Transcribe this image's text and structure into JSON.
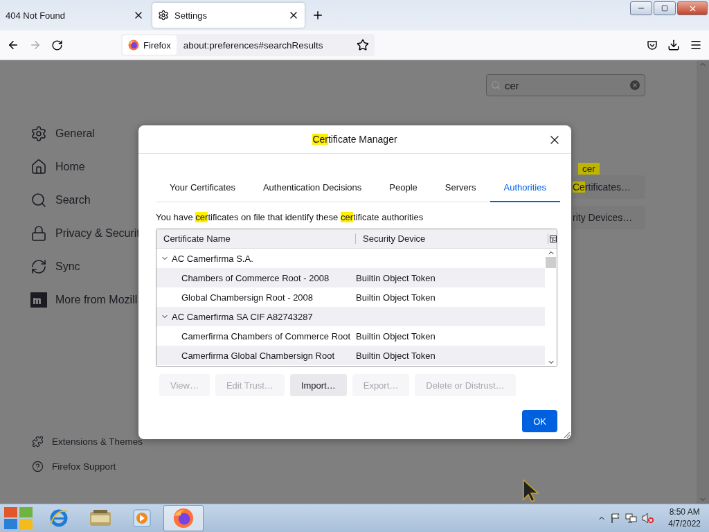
{
  "browser": {
    "tabs": [
      {
        "title": "404 Not Found",
        "selected": false
      },
      {
        "title": "Settings",
        "selected": true
      }
    ],
    "identity": "Firefox",
    "url": "about:preferences#searchResults"
  },
  "search": {
    "value": "cer"
  },
  "sidebar": {
    "items": [
      {
        "label": "General"
      },
      {
        "label": "Home"
      },
      {
        "label": "Search"
      },
      {
        "label": "Privacy & Securit"
      },
      {
        "label": "Sync"
      },
      {
        "label": "More from Mozill"
      }
    ],
    "footer": [
      {
        "label": "Extensions & Themes"
      },
      {
        "label": "Firefox Support"
      }
    ]
  },
  "results": {
    "tooltip": "cer",
    "buttons": [
      [
        {
          "text": "Ce",
          "highlighted": true
        },
        {
          "text": "rtificates…",
          "highlighted": false
        }
      ],
      [
        {
          "text": "rity Devices…",
          "highlighted": false
        }
      ]
    ]
  },
  "dialog": {
    "title": [
      {
        "text": "Cer",
        "highlighted": true
      },
      {
        "text": "tificate Manager",
        "highlighted": false
      }
    ],
    "tabs": [
      {
        "label": "Your Certificates",
        "selected": false
      },
      {
        "label": "Authentication Decisions",
        "selected": false
      },
      {
        "label": "People",
        "selected": false
      },
      {
        "label": "Servers",
        "selected": false
      },
      {
        "label": "Authorities",
        "selected": true
      }
    ],
    "description": [
      {
        "text": "You have ",
        "highlighted": false
      },
      {
        "text": "cer",
        "highlighted": true
      },
      {
        "text": "tificates on file that identify these ",
        "highlighted": false
      },
      {
        "text": "cer",
        "highlighted": true
      },
      {
        "text": "tificate authorities",
        "highlighted": false
      }
    ],
    "columns": [
      "Certificate Name",
      "Security Device"
    ],
    "groups": [
      {
        "name": "AC Camerfirma S.A.",
        "expanded": true,
        "children": [
          {
            "name": "Chambers of Commerce Root - 2008",
            "device": "Builtin Object Token"
          },
          {
            "name": "Global Chambersign Root - 2008",
            "device": "Builtin Object Token"
          }
        ]
      },
      {
        "name": "AC Camerfirma SA CIF A82743287",
        "expanded": true,
        "children": [
          {
            "name": "Camerfirma Chambers of Commerce Root",
            "device": "Builtin Object Token"
          },
          {
            "name": "Camerfirma Global Chambersign Root",
            "device": "Builtin Object Token"
          }
        ]
      }
    ],
    "buttons": [
      {
        "label": "View…",
        "disabled": true
      },
      {
        "label": "Edit Trust…",
        "disabled": true
      },
      {
        "label": "Import…",
        "disabled": false
      },
      {
        "label": "Export…",
        "disabled": true
      },
      {
        "label": "Delete or Distrust…",
        "disabled": true
      }
    ],
    "ok": "OK"
  },
  "taskbar": {
    "apps": [
      {
        "selected": false
      },
      {
        "selected": false
      },
      {
        "selected": false
      },
      {
        "selected": true
      }
    ],
    "time": "8:50 AM",
    "date": "4/7/2022"
  }
}
